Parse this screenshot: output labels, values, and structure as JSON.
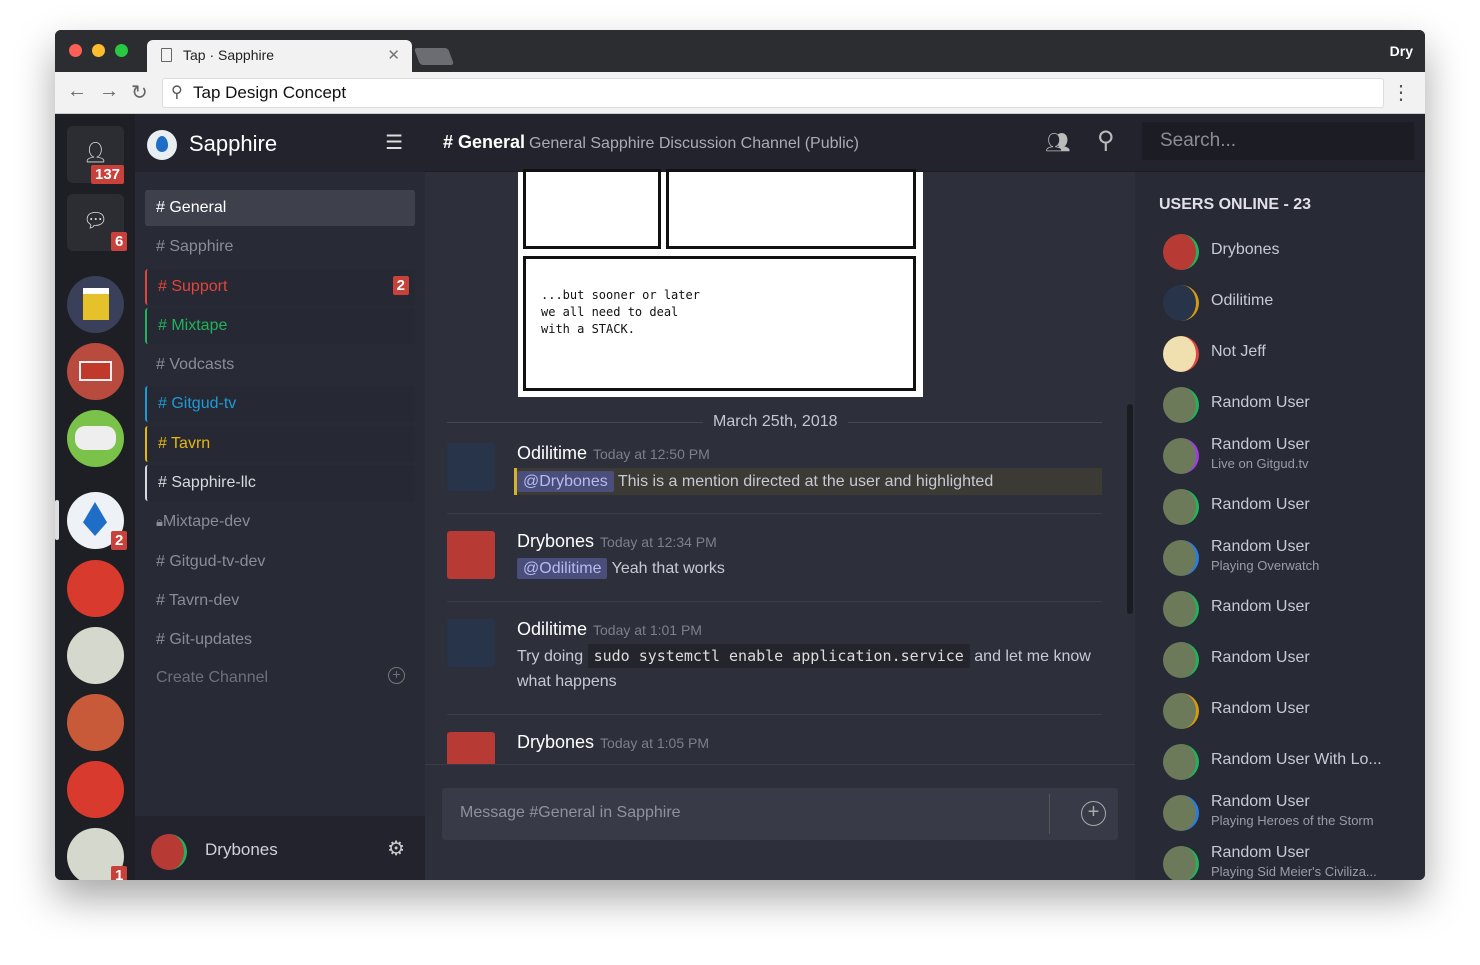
{
  "browser": {
    "tab_title": "Tap · Sapphire",
    "address": "Tap Design Concept",
    "profile": "Dry"
  },
  "rail": {
    "friends_badge": "137",
    "messages_badge": "6",
    "servers": [
      {
        "name": "beer",
        "badge": ""
      },
      {
        "name": "mixtape",
        "badge": ""
      },
      {
        "name": "gitgud",
        "badge": ""
      },
      {
        "name": "sapphire",
        "badge": "2"
      },
      {
        "name": "vioya-fm",
        "badge": ""
      },
      {
        "name": "anime",
        "badge": ""
      },
      {
        "name": "face",
        "badge": ""
      },
      {
        "name": "vioya-fm-2",
        "badge": ""
      },
      {
        "name": "anime-2",
        "badge": "1"
      }
    ]
  },
  "sidebar": {
    "app_name": "Sapphire",
    "channels": [
      {
        "label": "# General",
        "color": "#ffffff",
        "active": true
      },
      {
        "label": "# Sapphire",
        "color": "#8a8c96"
      },
      {
        "label": "# Support",
        "color": "#e0463c",
        "badge": "2"
      },
      {
        "label": "# Mixtape",
        "color": "#21b25a"
      },
      {
        "label": "# Vodcasts",
        "color": "#8a8c96"
      },
      {
        "label": "# Gitgud-tv",
        "color": "#1f9ad6"
      },
      {
        "label": "# Tavrn",
        "color": "#e4b80f"
      },
      {
        "label": "# Sapphire-llc",
        "color": "#d8d9de"
      },
      {
        "label": "Mixtape-dev",
        "color": "#8a8c96",
        "locked": true
      },
      {
        "label": "# Gitgud-tv-dev",
        "color": "#8a8c96"
      },
      {
        "label": "# Tavrn-dev",
        "color": "#8a8c96"
      },
      {
        "label": "# Git-updates",
        "color": "#8a8c96"
      }
    ],
    "create_channel": "Create Channel",
    "current_user": "Drybones"
  },
  "header": {
    "channel": "# General",
    "description": "General Sapphire Discussion Channel (Public)",
    "search_placeholder": "Search..."
  },
  "chat": {
    "comic_text": "...but sooner or later we all need to deal with a STACK.",
    "date_divider": "March 25th, 2018",
    "messages": [
      {
        "author": "Odilitime",
        "time": "Today at 12:50 PM",
        "mention": "@Drybones",
        "text": "This is a mention directed at the user and highlighted"
      },
      {
        "author": "Drybones",
        "time": "Today at 12:34 PM",
        "mention": "@Odilitime",
        "text": "Yeah that works"
      },
      {
        "author": "Odilitime",
        "time": "Today at 1:01 PM",
        "pre": "Try doing",
        "code": "sudo systemctl enable application.service",
        "post": "and let me know what happens"
      },
      {
        "author": "Drybones",
        "time": "Today at 1:05 PM"
      }
    ],
    "composer_placeholder": "Message #General in Sapphire"
  },
  "users": {
    "heading": "USERS ONLINE - 23",
    "list": [
      {
        "name": "Drybones",
        "status": "",
        "ring": "#21b25a"
      },
      {
        "name": "Odilitime",
        "status": "",
        "ring": "#d49a12"
      },
      {
        "name": "Not Jeff",
        "status": "",
        "ring": "#e0463c"
      },
      {
        "name": "Random User",
        "status": "",
        "ring": "#21b25a"
      },
      {
        "name": "Random User",
        "status": "Live on Gitgud.tv",
        "ring": "#9b3fe0"
      },
      {
        "name": "Random User",
        "status": "",
        "ring": "#21b25a"
      },
      {
        "name": "Random User",
        "status": "Playing Overwatch",
        "ring": "#2a7de0"
      },
      {
        "name": "Random User",
        "status": "",
        "ring": "#21b25a"
      },
      {
        "name": "Random User",
        "status": "",
        "ring": "#21b25a"
      },
      {
        "name": "Random User",
        "status": "",
        "ring": "#d49a12"
      },
      {
        "name": "Random User With Lo...",
        "status": "",
        "ring": "#21b25a"
      },
      {
        "name": "Random User",
        "status": "Playing Heroes of the Storm",
        "ring": "#2a7de0"
      },
      {
        "name": "Random User",
        "status": "Playing Sid Meier's Civiliza...",
        "ring": "#21b25a"
      }
    ]
  }
}
